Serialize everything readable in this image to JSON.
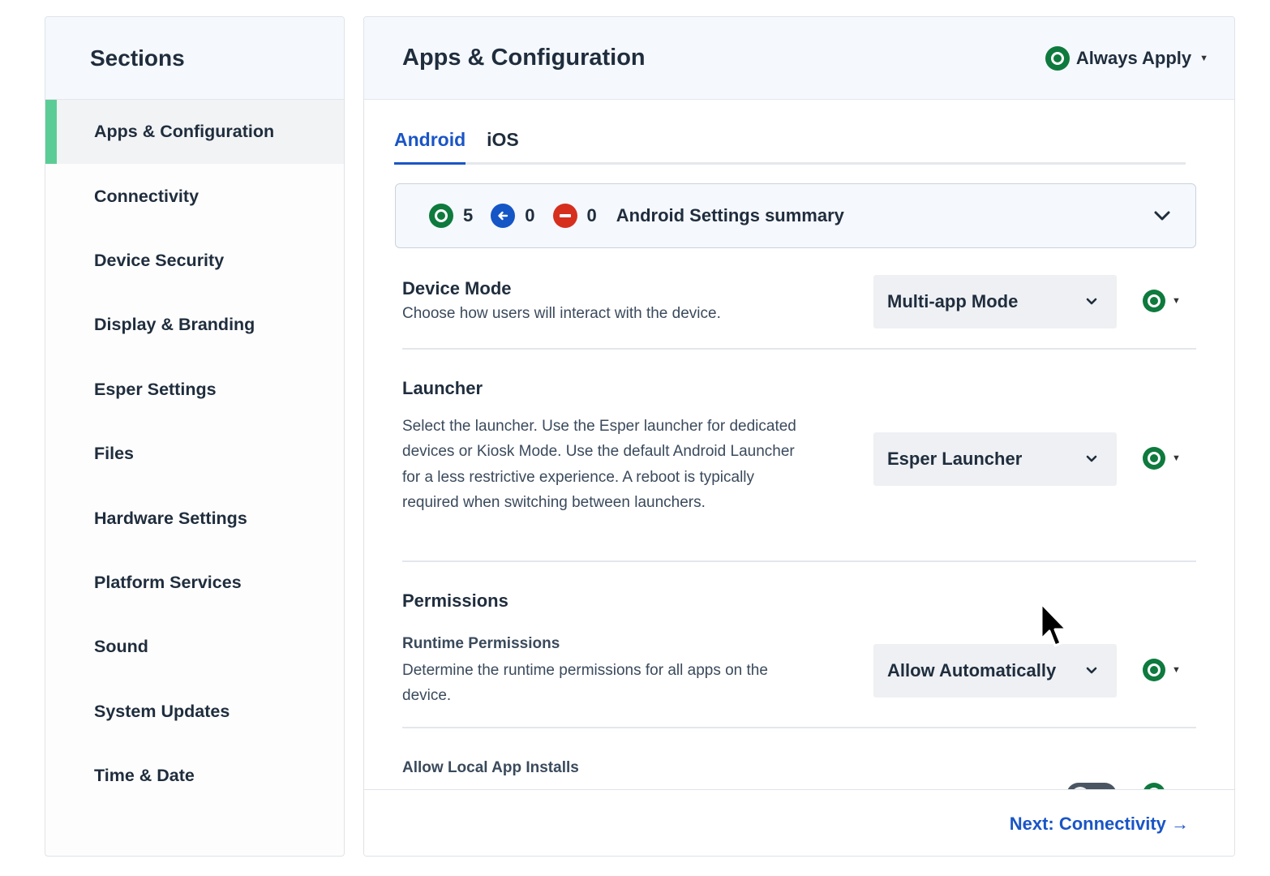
{
  "sidebar": {
    "title": "Sections",
    "items": [
      {
        "label": "Apps & Configuration",
        "active": true
      },
      {
        "label": "Connectivity"
      },
      {
        "label": "Device Security"
      },
      {
        "label": "Display & Branding"
      },
      {
        "label": "Esper Settings"
      },
      {
        "label": "Files"
      },
      {
        "label": "Hardware Settings"
      },
      {
        "label": "Platform Services"
      },
      {
        "label": "Sound"
      },
      {
        "label": "System Updates"
      },
      {
        "label": "Time & Date"
      }
    ]
  },
  "main": {
    "title": "Apps & Configuration",
    "apply_mode": "Always Apply",
    "tabs": [
      {
        "label": "Android",
        "active": true
      },
      {
        "label": "iOS"
      }
    ],
    "summary": {
      "applied_count": "5",
      "inherited_count": "0",
      "removed_count": "0",
      "title": "Android Settings summary"
    },
    "settings": {
      "device_mode": {
        "title": "Device Mode",
        "description": "Choose how users will interact with the device.",
        "value": "Multi-app Mode"
      },
      "launcher": {
        "title": "Launcher",
        "description": "Select the launcher. Use the Esper launcher for dedicated devices or Kiosk Mode. Use the default Android Launcher for a less restrictive experience. A reboot is typically required when switching between launchers.",
        "value": "Esper Launcher"
      },
      "permissions": {
        "title": "Permissions",
        "runtime_title": "Runtime Permissions",
        "runtime_description": "Determine the runtime permissions for all apps on the device.",
        "value": "Allow Automatically"
      },
      "local_installs": {
        "title": "Allow Local App Installs"
      }
    },
    "footer": {
      "next_label": "Next: Connectivity →"
    }
  },
  "colors": {
    "accent_blue": "#1a55c6",
    "active_green": "#5ccc96",
    "status_green": "#0e7a3e",
    "status_red": "#d62f1e"
  }
}
